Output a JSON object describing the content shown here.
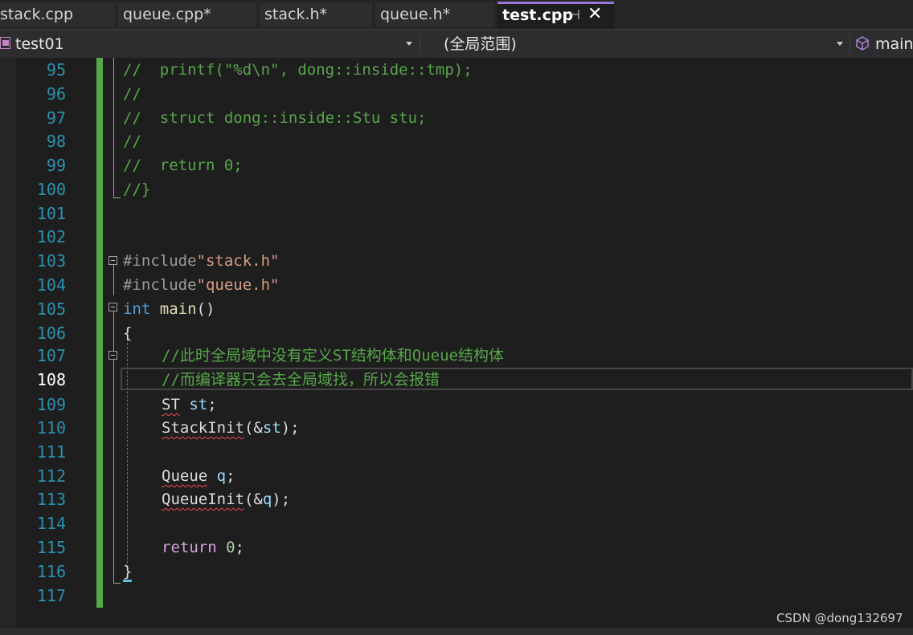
{
  "tabs": [
    {
      "label": "stack.cpp"
    },
    {
      "label": "queue.cpp*"
    },
    {
      "label": "stack.h*"
    },
    {
      "label": "queue.h*"
    },
    {
      "label": "test.cpp",
      "active": true
    }
  ],
  "tab_icons": {
    "pin": "⊣",
    "close": "✕"
  },
  "navbar": {
    "project": "test01",
    "scope": "(全局范围)",
    "member": "main("
  },
  "editor": {
    "current_line": "108",
    "lines": [
      {
        "n": "95"
      },
      {
        "n": "96"
      },
      {
        "n": "97"
      },
      {
        "n": "98"
      },
      {
        "n": "99"
      },
      {
        "n": "100"
      },
      {
        "n": "101"
      },
      {
        "n": "102"
      },
      {
        "n": "103"
      },
      {
        "n": "104"
      },
      {
        "n": "105"
      },
      {
        "n": "106"
      },
      {
        "n": "107"
      },
      {
        "n": "108"
      },
      {
        "n": "109"
      },
      {
        "n": "110"
      },
      {
        "n": "111"
      },
      {
        "n": "112"
      },
      {
        "n": "113"
      },
      {
        "n": "114"
      },
      {
        "n": "115"
      },
      {
        "n": "116"
      },
      {
        "n": "117"
      }
    ],
    "code": {
      "l95": "//  printf(\"%d\\n\", dong::inside::tmp);",
      "l96": "//",
      "l97": "//  struct dong::inside::Stu stu;",
      "l98": "//",
      "l99": "//  return 0;",
      "l100": "//}",
      "l103_pre": "#include",
      "l103_str": "\"stack.h\"",
      "l104_pre": "#include",
      "l104_str": "\"queue.h\"",
      "l105_kw": "int",
      "l105_fn": "main",
      "l105_rest": "()",
      "l106": "{",
      "l107": "//此时全局域中没有定义ST结构体和Queue结构体",
      "l108": "//而编译器只会去全局域找，所以会报错",
      "l109_type": "ST",
      "l109_var": "st",
      "l109_end": ";",
      "l110_fn": "StackInit",
      "l110_open": "(&",
      "l110_var": "st",
      "l110_close": ");",
      "l112_type": "Queue",
      "l112_var": "q",
      "l112_end": ";",
      "l113_fn": "QueueInit",
      "l113_open": "(&",
      "l113_var": "q",
      "l113_close": ");",
      "l115_kw": "return",
      "l115_num": "0",
      "l115_end": ";",
      "l116": "}"
    }
  },
  "watermark": "CSDN @dong132697"
}
